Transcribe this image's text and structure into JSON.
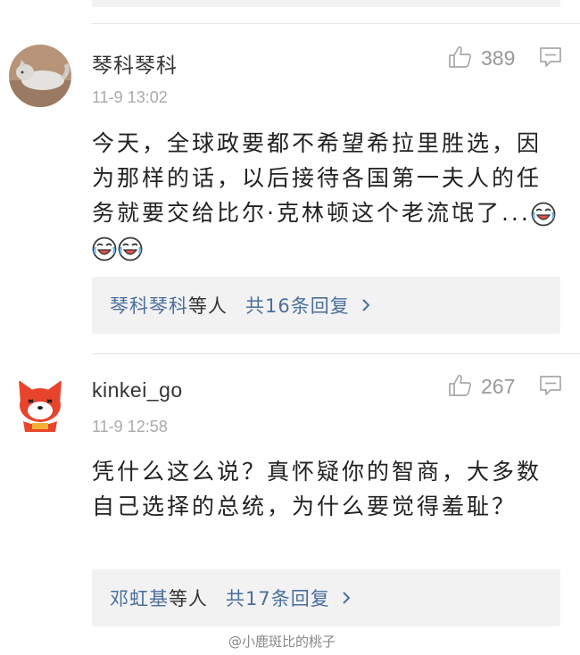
{
  "comments": [
    {
      "username": "琴科琴科",
      "time": "11-9 13:02",
      "likes": "389",
      "text": "今天，全球政要都不希望希拉里胜选，因为那样的话，以后接待各国第一夫人的任务就要交给比尔·克林顿这个老流氓了...",
      "emoji_count": 3,
      "reply_names": "琴科琴科",
      "reply_etc": "等人",
      "reply_total": "共16条回复"
    },
    {
      "username": "kinkei_go",
      "time": "11-9 12:58",
      "likes": "267",
      "text": "凭什么这么说？真怀疑你的智商，大多数自己选择的总统，为什么要觉得羞耻？",
      "reply_names": "邓虹基",
      "reply_etc": "等人",
      "reply_total": "共17条回复"
    }
  ],
  "watermark": "@小鹿斑比的桃子",
  "colors": {
    "link": "#4a6f9c",
    "muted": "#999999",
    "panel": "#f2f2f2",
    "avatar_fox": "#e8442c"
  }
}
